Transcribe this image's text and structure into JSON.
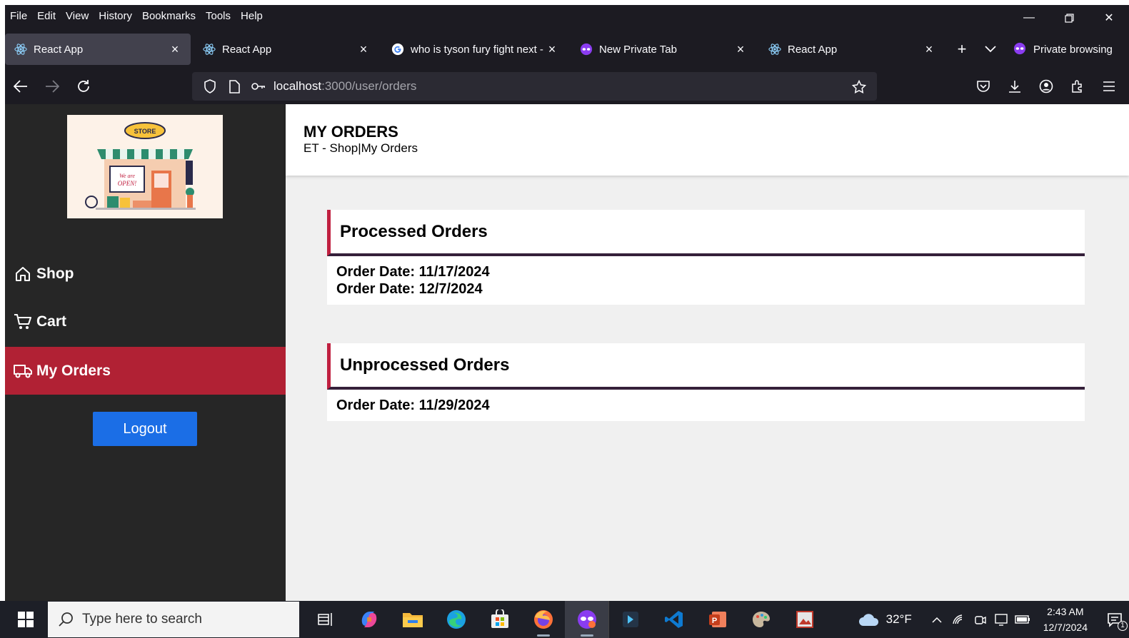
{
  "browser": {
    "menu": [
      "File",
      "Edit",
      "View",
      "History",
      "Bookmarks",
      "Tools",
      "Help"
    ],
    "tabs": [
      {
        "title": "React App",
        "icon": "react-icon"
      },
      {
        "title": "React App",
        "icon": "react-icon"
      },
      {
        "title": "who is tyson fury fight next - ",
        "icon": "google-icon"
      },
      {
        "title": "New Private Tab",
        "icon": "private-mask-icon"
      },
      {
        "title": "React App",
        "icon": "react-icon"
      }
    ],
    "private_label": "Private browsing",
    "url_host": "localhost",
    "url_rest": ":3000/user/orders"
  },
  "sidebar": {
    "items": [
      {
        "label": "Shop",
        "icon": "home-icon"
      },
      {
        "label": "Cart",
        "icon": "cart-icon"
      },
      {
        "label": "My Orders",
        "icon": "truck-icon"
      }
    ],
    "logout_label": "Logout",
    "logo_text": "STORE"
  },
  "header": {
    "title": "MY ORDERS",
    "breadcrumb": "ET - Shop|My Orders"
  },
  "sections": [
    {
      "title": "Processed Orders",
      "orders": [
        "Order Date: 11/17/2024",
        "Order Date: 12/7/2024"
      ]
    },
    {
      "title": "Unprocessed Orders",
      "orders": [
        "Order Date: 11/29/2024"
      ]
    }
  ],
  "taskbar": {
    "search_placeholder": "Type here to search",
    "weather": "32°F",
    "time": "2:43 AM",
    "date": "12/7/2024",
    "notification_count": "1"
  },
  "colors": {
    "sidebar_bg": "#262626",
    "active_item": "#b12134",
    "logout_button": "#1b6ee6",
    "card_accent": "#c02040",
    "card_rule": "#35203a"
  }
}
